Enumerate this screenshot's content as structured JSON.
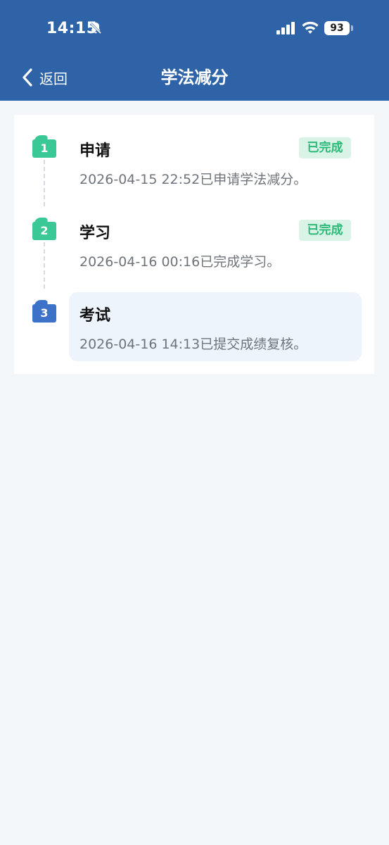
{
  "status_bar": {
    "time": "14:15",
    "battery": "93",
    "icons": [
      "bell-slash-icon",
      "signal-icon",
      "wifi-icon",
      "battery-icon"
    ]
  },
  "header": {
    "back_label": "返回",
    "title": "学法减分",
    "background": "#2f63a8"
  },
  "steps": [
    {
      "number": "1",
      "title": "申请",
      "description": "2026-04-15 22:52已申请学法减分。",
      "status": "已完成",
      "completed": true
    },
    {
      "number": "2",
      "title": "学习",
      "description": "2026-04-16 00:16已完成学习。",
      "status": "已完成",
      "completed": true
    },
    {
      "number": "3",
      "title": "考试",
      "description": "2026-04-16 14:13已提交成绩复核。",
      "completed": false
    }
  ],
  "colors": {
    "done": "#39c896",
    "active": "#3c72c8",
    "badge_text": "#2cba79",
    "badge_bg": "#d9f3e6"
  }
}
